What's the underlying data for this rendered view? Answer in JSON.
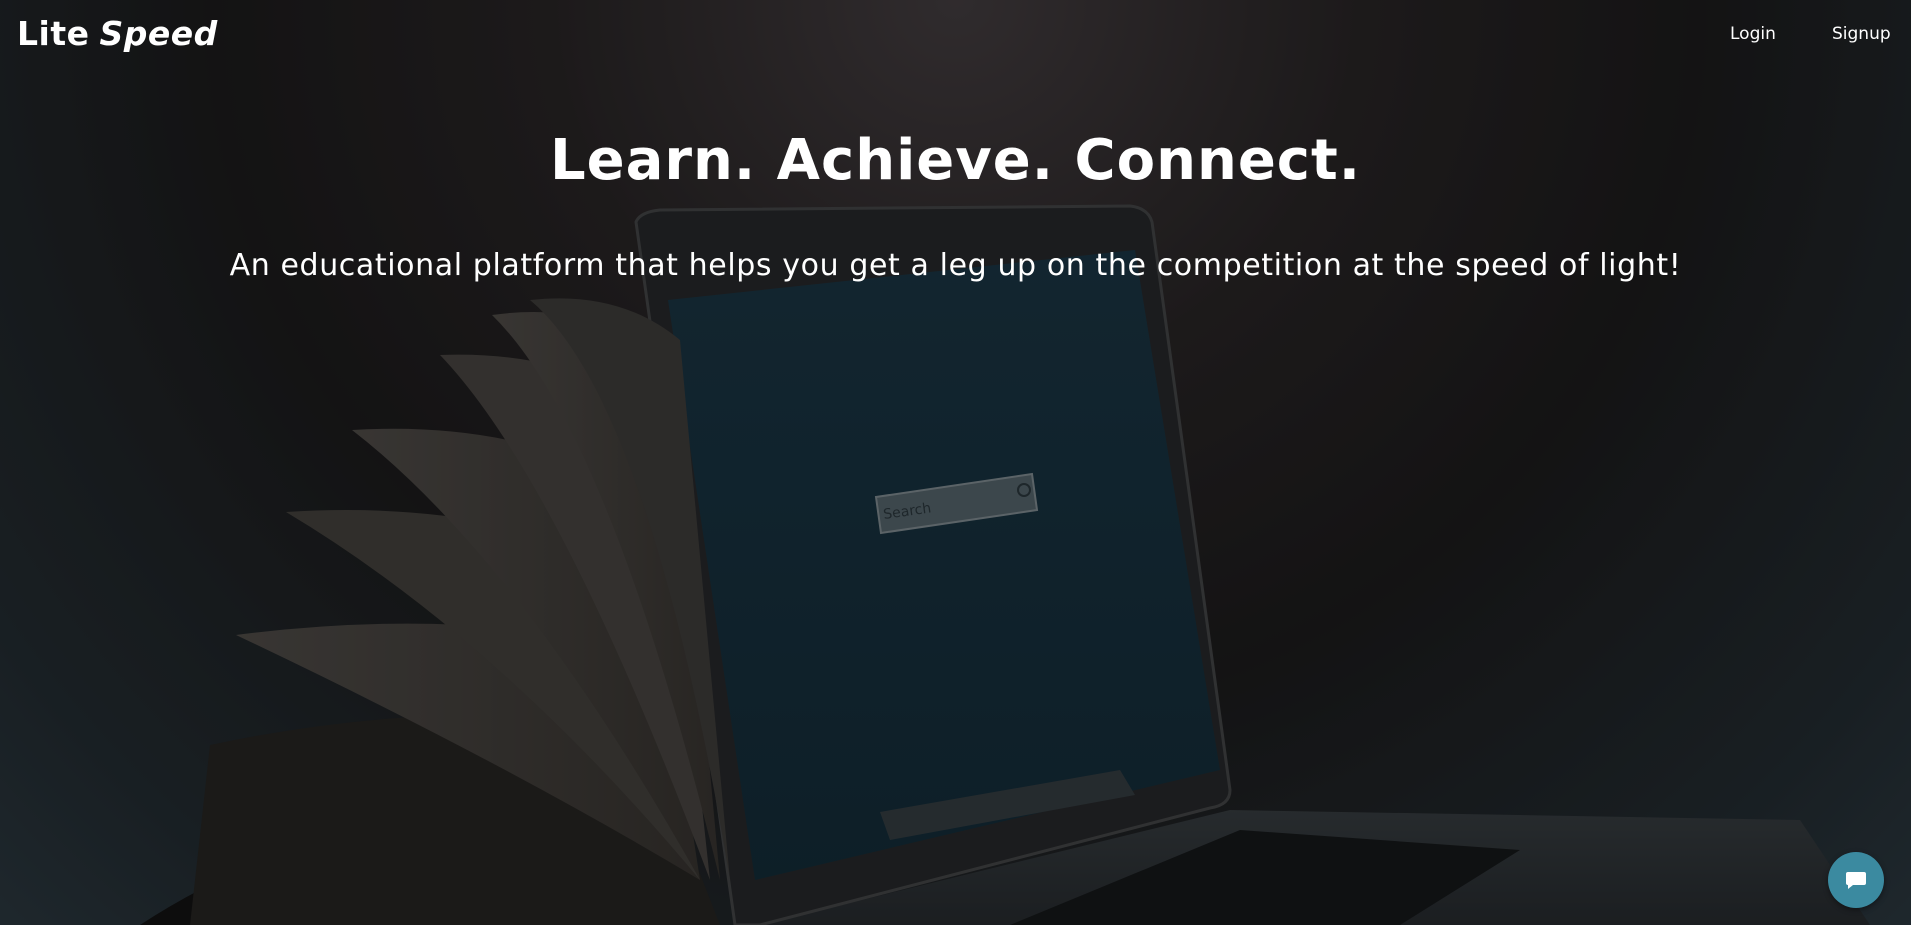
{
  "navbar": {
    "logo_main": "Lite",
    "logo_accent": "Speed",
    "login_label": "Login",
    "signup_label": "Signup"
  },
  "hero": {
    "headline": "Learn. Achieve. Connect.",
    "subheadline": "An educational platform that helps you get a leg up on the competition at the speed of light!",
    "background_image": "laptop-and-open-book",
    "screen_search_placeholder": "Search"
  },
  "chat": {
    "icon": "chat-bubble-icon",
    "color": "#3b8aa0"
  },
  "colors": {
    "text": "#ffffff",
    "accent": "#3b8aa0"
  }
}
